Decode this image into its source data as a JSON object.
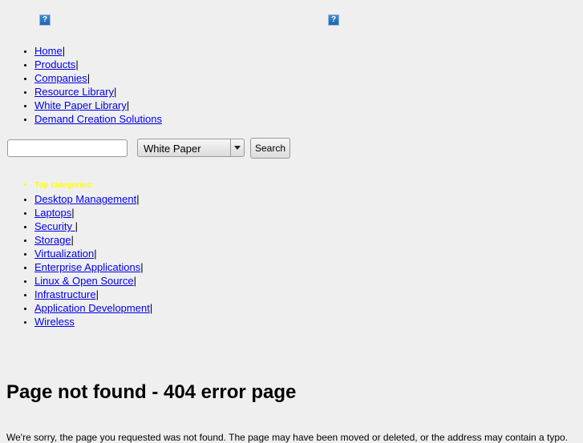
{
  "images": {
    "left_icon": "broken-image-icon",
    "right_icon": "broken-image-icon",
    "glyph": "?"
  },
  "nav": {
    "separator": "|",
    "items": [
      {
        "label": "Home",
        "sep": true
      },
      {
        "label": "Products",
        "sep": true
      },
      {
        "label": "Companies",
        "sep": true
      },
      {
        "label": "Resource Library",
        "sep": true
      },
      {
        "label": "White Paper Library",
        "sep": true
      },
      {
        "label": "Demand Creation Solutions",
        "sep": false
      }
    ]
  },
  "search": {
    "input_value": "",
    "select_value": "White Paper",
    "button_label": "Search"
  },
  "categories": {
    "heading": "Top categories:",
    "items": [
      {
        "label": "Desktop Management",
        "sep": "|"
      },
      {
        "label": "Laptops",
        "sep": "|"
      },
      {
        "label": "Security ",
        "sep": "|"
      },
      {
        "label": "Storage",
        "sep": "|"
      },
      {
        "label": "Virtualization",
        "sep": "|"
      },
      {
        "label": "Enterprise Applications",
        "sep": "|"
      },
      {
        "label": "Linux & Open Source",
        "sep": "|"
      },
      {
        "label": "Infrastructure",
        "sep": "|"
      },
      {
        "label": "Application Development",
        "sep": "|"
      },
      {
        "label": "Wireless",
        "sep": ""
      }
    ]
  },
  "main": {
    "title": "Page not found - 404 error page",
    "body": "We're sorry, the page you requested was not found. The page may have been moved or deleted, or the address may contain a typo."
  }
}
